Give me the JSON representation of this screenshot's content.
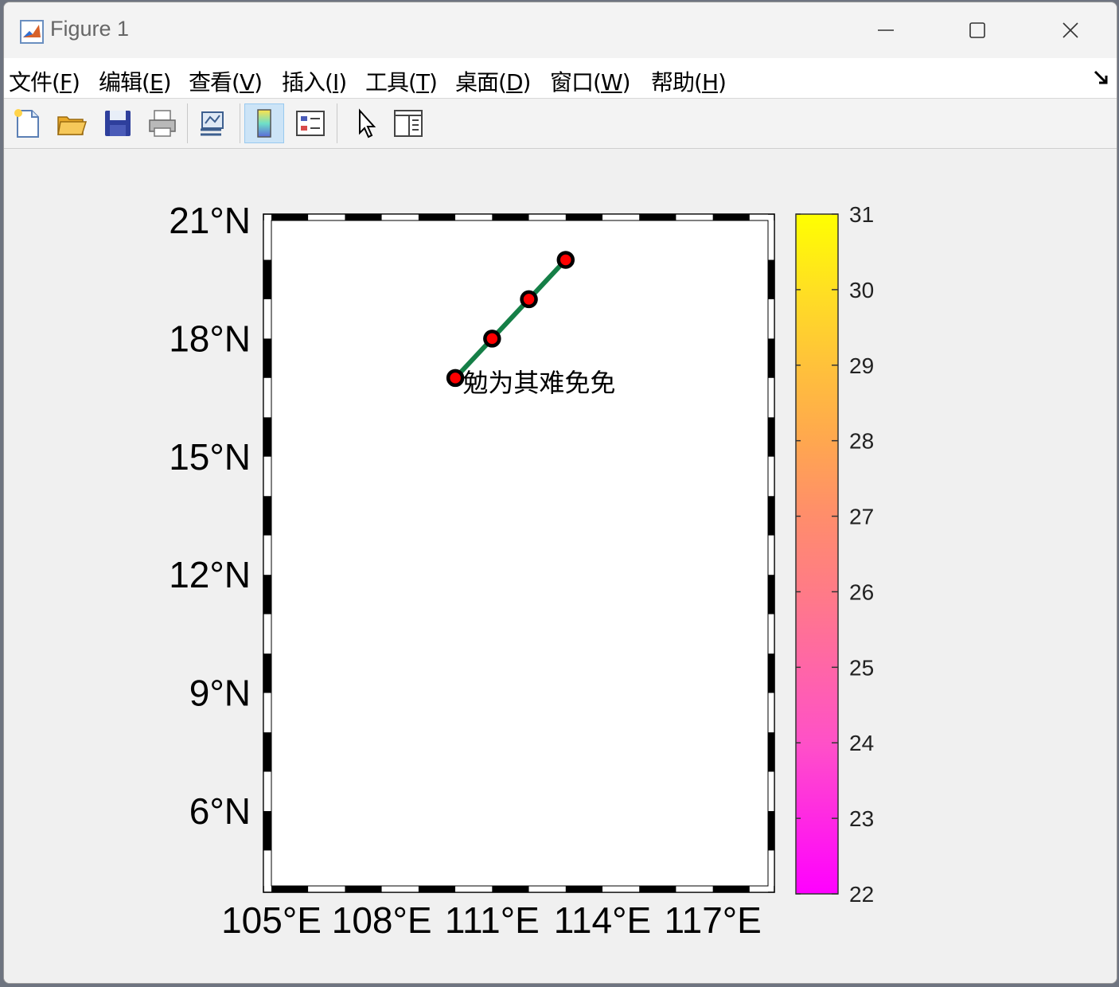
{
  "window": {
    "title": "Figure 1"
  },
  "menu": [
    {
      "label": "文件(",
      "key": "F",
      "end": ")"
    },
    {
      "label": "编辑(",
      "key": "E",
      "end": ")"
    },
    {
      "label": "查看(",
      "key": "V",
      "end": ")"
    },
    {
      "label": "插入(",
      "key": "I",
      "end": ")"
    },
    {
      "label": "工具(",
      "key": "T",
      "end": ")"
    },
    {
      "label": "桌面(",
      "key": "D",
      "end": ")"
    },
    {
      "label": "窗口(",
      "key": "W",
      "end": ")"
    },
    {
      "label": "帮助(",
      "key": "H",
      "end": ")"
    }
  ],
  "toolbar_icons": [
    "new-figure-icon",
    "open-file-icon",
    "save-icon",
    "print-icon",
    "link-plot-icon",
    "colorbar-icon",
    "legend-icon",
    "pointer-icon",
    "property-inspector-icon"
  ],
  "chart_data": {
    "type": "map",
    "xlim": [
      105,
      118.5
    ],
    "ylim": [
      4.1,
      21
    ],
    "x_ticks": [
      105,
      108,
      111,
      114,
      117
    ],
    "x_tick_labels": [
      "105°E",
      "108°E",
      "111°E",
      "114°E",
      "117°E"
    ],
    "y_ticks": [
      21,
      18,
      15,
      12,
      9,
      6
    ],
    "y_tick_labels": [
      "21°N",
      "18°N",
      "15°N",
      "12°N",
      "9°N",
      "6°N"
    ],
    "colorbar": {
      "min": 22,
      "max": 31,
      "ticks": [
        22,
        23,
        24,
        25,
        26,
        27,
        28,
        29,
        30,
        31
      ],
      "colors": [
        "#ff00ff",
        "#ff80ff",
        "#ff6f9a",
        "#ff8a7a",
        "#ffaa55",
        "#ffc640",
        "#ffdf28",
        "#ffff00"
      ]
    },
    "colors": {
      "land": "#b4b4b4",
      "track": "#157f47",
      "marker": "#ff0000"
    },
    "track": [
      {
        "lon": 110.0,
        "lat": 17.0
      },
      {
        "lon": 111.0,
        "lat": 18.0
      },
      {
        "lon": 112.0,
        "lat": 19.0
      },
      {
        "lon": 113.0,
        "lat": 20.0
      }
    ],
    "annotation": {
      "text": "勉为其难免免",
      "lon": 110.2,
      "lat": 16.9
    }
  }
}
